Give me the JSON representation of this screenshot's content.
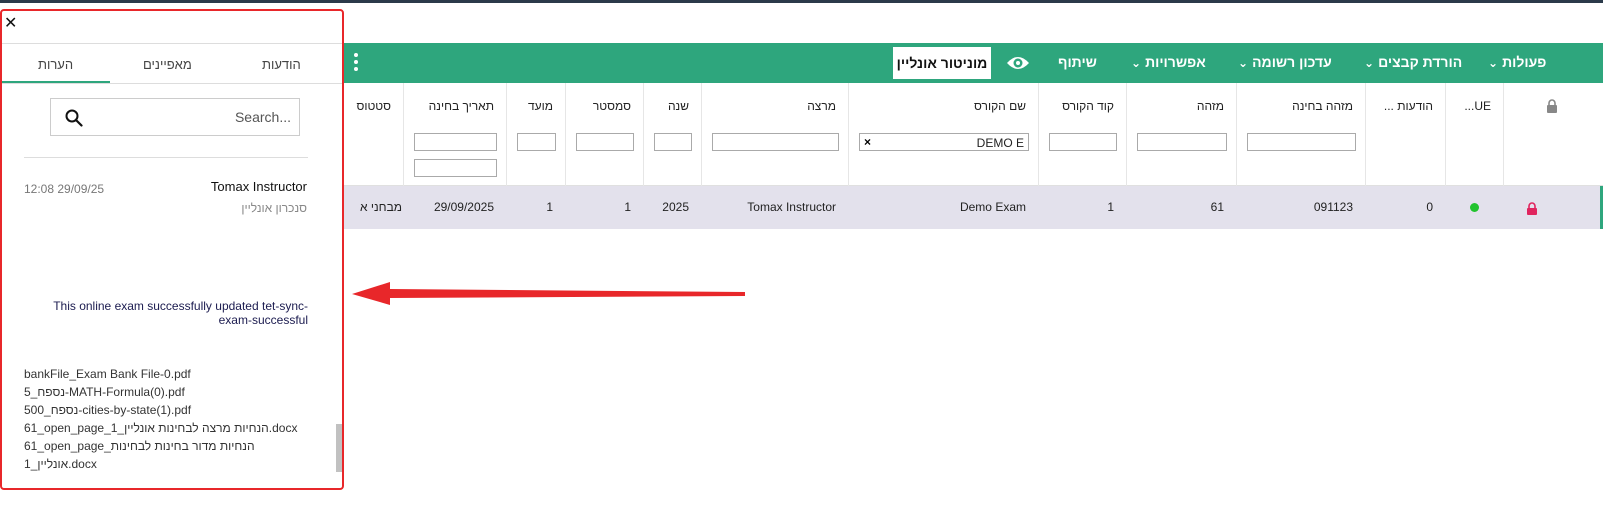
{
  "toolbar": {
    "actions": "פעולות",
    "download_files": "הורדת קבצים",
    "update_list": "עדכון רשומה",
    "options": "אפשרויות",
    "share": "שיתוף",
    "monitor": "מוניטור אונליין",
    "accent_color": "#2ea67d"
  },
  "columns": {
    "lock": "",
    "ue": "UE...",
    "notes": "הודעות ...",
    "exam_id": "מזהה בחינה",
    "id": "מזהה",
    "course_code": "קוד הקורס",
    "course_name": "שם הקורס",
    "lecturer": "מרצה",
    "year": "שנה",
    "semester": "סמסטר",
    "term": "מועד",
    "exam_date": "תאריך בחינה",
    "status": "סטטוס"
  },
  "filters": {
    "course_name_value": "DEMO E"
  },
  "row": {
    "status_dot_color": "#22c32e",
    "lock_color": "#e0245e",
    "notes": "0",
    "exam_id": "091123",
    "id": "61",
    "course_code": "1",
    "course_name": "Demo Exam",
    "lecturer": "Tomax Instructor",
    "year": "2025",
    "semester": "1",
    "term": "1",
    "exam_date": "29/09/2025",
    "status": "מבחני א"
  },
  "panel": {
    "tabs": {
      "notifications": "הודעות",
      "properties": "מאפיינים",
      "comments": "הערות"
    },
    "active_tab": "comments",
    "search_placeholder": "Search...",
    "note": {
      "author": "Tomax Instructor",
      "time": "12:08 29/09/25",
      "source": "סנכרון אונליין",
      "message": "This online exam successfully updated tet-sync-exam-successful",
      "files": [
        "bankFile_Exam Bank File-0.pdf",
        "5_נספח-MATH-Formula(0).pdf",
        "500_נספח-cities-by-state(1).pdf",
        "61_open_page_1_הנחיות מרצה לבחינות אונליין.docx",
        "61_open_page_הנחיות מדור בחינות לבחינות",
        "אונליין_1.docx"
      ]
    }
  }
}
